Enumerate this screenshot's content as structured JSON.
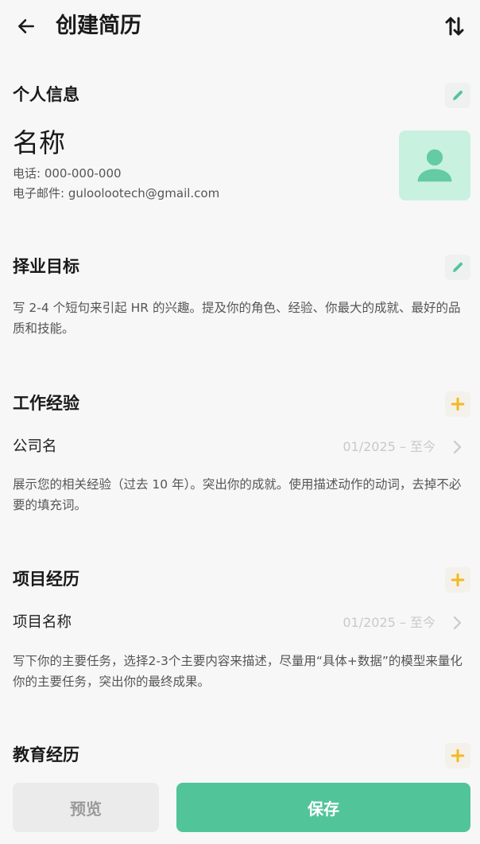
{
  "header": {
    "title": "创建简历"
  },
  "personal": {
    "section_title": "个人信息",
    "name": "名称",
    "phone": "电话: 000-000-000",
    "email": "电子邮件: guloolootech@gmail.com"
  },
  "objective": {
    "section_title": "择业目标",
    "description": "写 2-4 个短句来引起 HR 的兴趣。提及你的角色、经验、你最大的成就、最好的品质和技能。"
  },
  "work": {
    "section_title": "工作经验",
    "item_label": "公司名",
    "item_date": "01/2025 – 至今",
    "description": "展示您的相关经验（过去 10 年）。突出你的成就。使用描述动作的动词，去掉不必要的填充词。"
  },
  "projects": {
    "section_title": "项目经历",
    "item_label": "项目名称",
    "item_date": "01/2025 – 至今",
    "description": "写下你的主要任务，选择2-3个主要内容来描述，尽量用“具体+数据”的模型来量化你的主要任务，突出你的最终成果。"
  },
  "education": {
    "section_title": "教育经历"
  },
  "footer": {
    "preview_label": "预览",
    "save_label": "保存"
  },
  "colors": {
    "accent": "#52c49a",
    "add_icon": "#f5b820",
    "avatar_bg": "#c9f1e0"
  },
  "icons": {
    "back": "arrow-left-icon",
    "sort": "sort-arrows-icon",
    "edit": "pencil-icon",
    "add": "plus-icon",
    "chevron": "chevron-right-icon",
    "avatar": "person-icon"
  }
}
